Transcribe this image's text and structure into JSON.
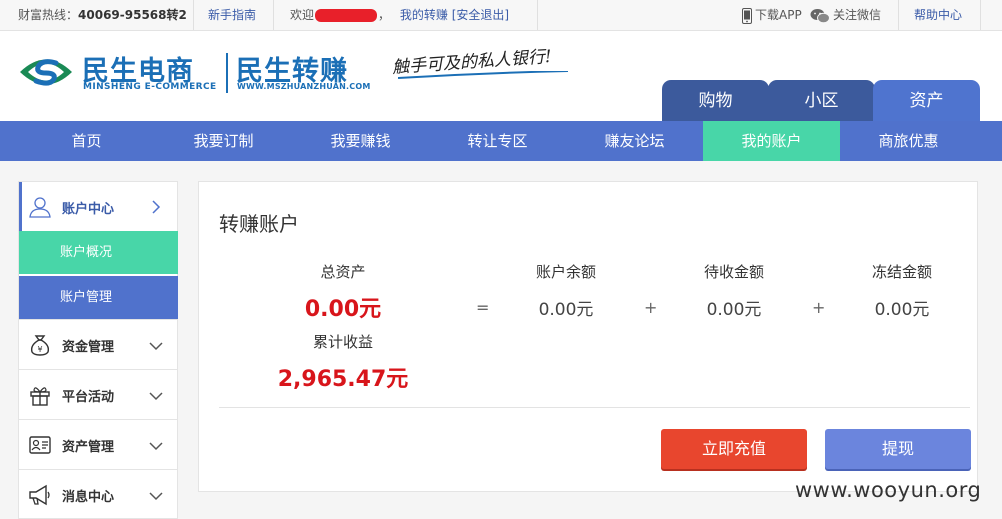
{
  "topbar": {
    "hotline_label": "财富热线：",
    "hotline_number": "40069-95568转2",
    "guide_link": "新手指南",
    "welcome_prefix": "欢迎",
    "welcome_suffix": "，",
    "my_zhuanzhuan_link": "我的转赚",
    "logout_open": "[",
    "logout_link": "安全退出",
    "logout_close": "]",
    "download_app": "下载APP",
    "follow_wechat": "关注微信",
    "help_center": "帮助中心"
  },
  "header": {
    "brand_cn": "民生电商",
    "brand_en": "MINSHENG E-COMMERCE",
    "brand2_cn": "民生转赚",
    "brand2_url": "WWW.MSZHUANZHUAN.COM",
    "slogan": "触手可及的私人银行!",
    "tabs": [
      {
        "label": "购物"
      },
      {
        "label": "小区"
      },
      {
        "label": "资产"
      }
    ]
  },
  "nav": {
    "items": [
      {
        "label": "首页"
      },
      {
        "label": "我要订制"
      },
      {
        "label": "我要赚钱"
      },
      {
        "label": "转让专区"
      },
      {
        "label": "赚友论坛"
      },
      {
        "label": "我的账户"
      },
      {
        "label": "商旅优惠"
      }
    ]
  },
  "sidebar": {
    "head": "账户中心",
    "sub": [
      "账户概况",
      "账户管理"
    ],
    "items": [
      {
        "label": "资金管理",
        "icon": "money-bag-icon"
      },
      {
        "label": "平台活动",
        "icon": "gift-icon"
      },
      {
        "label": "资产管理",
        "icon": "id-card-icon"
      },
      {
        "label": "消息中心",
        "icon": "megaphone-icon"
      }
    ]
  },
  "main": {
    "title": "转赚账户",
    "total_assets_label": "总资产",
    "total_assets_value": "0.00元",
    "balance_label": "账户余额",
    "balance_value": "0.00元",
    "pending_label": "待收金额",
    "pending_value": "0.00元",
    "frozen_label": "冻结金额",
    "frozen_value": "0.00元",
    "op_equals": "=",
    "op_plus": "+",
    "cumulative_label": "累计收益",
    "cumulative_value": "2,965.47元",
    "recharge_button": "立即充值",
    "withdraw_button": "提现"
  },
  "watermark": "www.wooyun.org",
  "colors": {
    "brand_blue": "#1b6fb6",
    "nav_blue": "#5072cc",
    "active_green": "#48d6a8",
    "amount_red": "#d8151b",
    "recharge_red": "#e8462e",
    "withdraw_blue": "#6b85dd"
  }
}
